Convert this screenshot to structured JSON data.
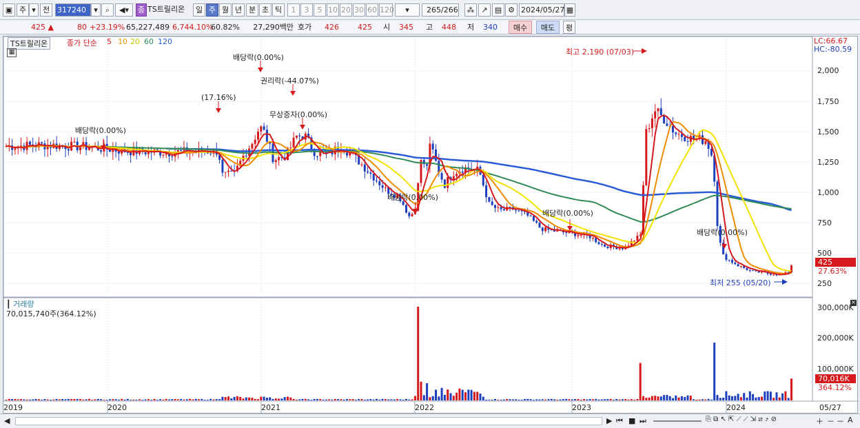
{
  "toolbar": {
    "market_type": "주",
    "prev_label": "전",
    "code": "317240",
    "stock_badge": "종",
    "stock_name": "TS트릴리온",
    "periods": [
      "일",
      "주",
      "월",
      "년",
      "분",
      "초",
      "틱"
    ],
    "selected_period": "주",
    "intervals": [
      "1",
      "3",
      "5",
      "10",
      "20",
      "30",
      "60",
      "120"
    ],
    "count_current": "265",
    "count_total": "/266",
    "date": "2024/05/27"
  },
  "quote": {
    "price": "425",
    "change": "80",
    "change_rate": "+23.19%",
    "volume": "65,227,489",
    "volume_rate": "6,744.10%",
    "turnover": "60.82%",
    "amount": "27,290백만",
    "bid_label": "호가",
    "bid1": "426",
    "bid2": "425",
    "open_label": "시",
    "open": "345",
    "high_label": "고",
    "high": "448",
    "low_label": "저",
    "low": "340",
    "buy_label": "매수",
    "sell_label": "매도",
    "eval_label": "평"
  },
  "legend": {
    "name": "TS트릴리온",
    "ma_label": "종가 단순",
    "ma_periods": [
      "5",
      "10",
      "20",
      "60",
      "120"
    ],
    "ma_colors": [
      "#d5191c",
      "#e69c00",
      "#c8c800",
      "#2e8b57",
      "#2a5bd7"
    ]
  },
  "price_axis": {
    "lc": "LC:66.67",
    "hc": "HC:-80.59",
    "ticks": [
      "2,000",
      "1,750",
      "1,500",
      "1,250",
      "1,000",
      "750",
      "500",
      "250"
    ],
    "current_price": "425",
    "current_rate": "27.63%"
  },
  "annotations": [
    {
      "text": "배당락(0.00%)"
    },
    {
      "text": "(17.16%)"
    },
    {
      "text": "배당락(0.00%)"
    },
    {
      "text": "권리락(-44.07%)"
    },
    {
      "text": "무상증자(0.00%)"
    },
    {
      "text": "배당락(0.00%)"
    },
    {
      "text": "배당락(0.00%)"
    },
    {
      "text": "배당락(0.00%)"
    },
    {
      "text": "최고 2,190 (07/03)"
    },
    {
      "text": "최저 255 (05/20)"
    }
  ],
  "volume_pane": {
    "title": "거래량",
    "value": "70,015,740주(364.12%)",
    "ticks": [
      "300,000K",
      "200,000K",
      "100,000K"
    ],
    "current": "70,016K",
    "current_rate": "364.12%"
  },
  "x_axis": {
    "years": [
      "2019",
      "2020",
      "2021",
      "2022",
      "2023",
      "2024"
    ],
    "end_date": "05/27"
  },
  "colors": {
    "up": "#d5191c",
    "down": "#1c3fbe",
    "ma5": "#d5191c",
    "ma10": "#f08c00",
    "ma20": "#f2e200",
    "ma60": "#2e8b57",
    "ma120": "#2a5bd7"
  }
}
